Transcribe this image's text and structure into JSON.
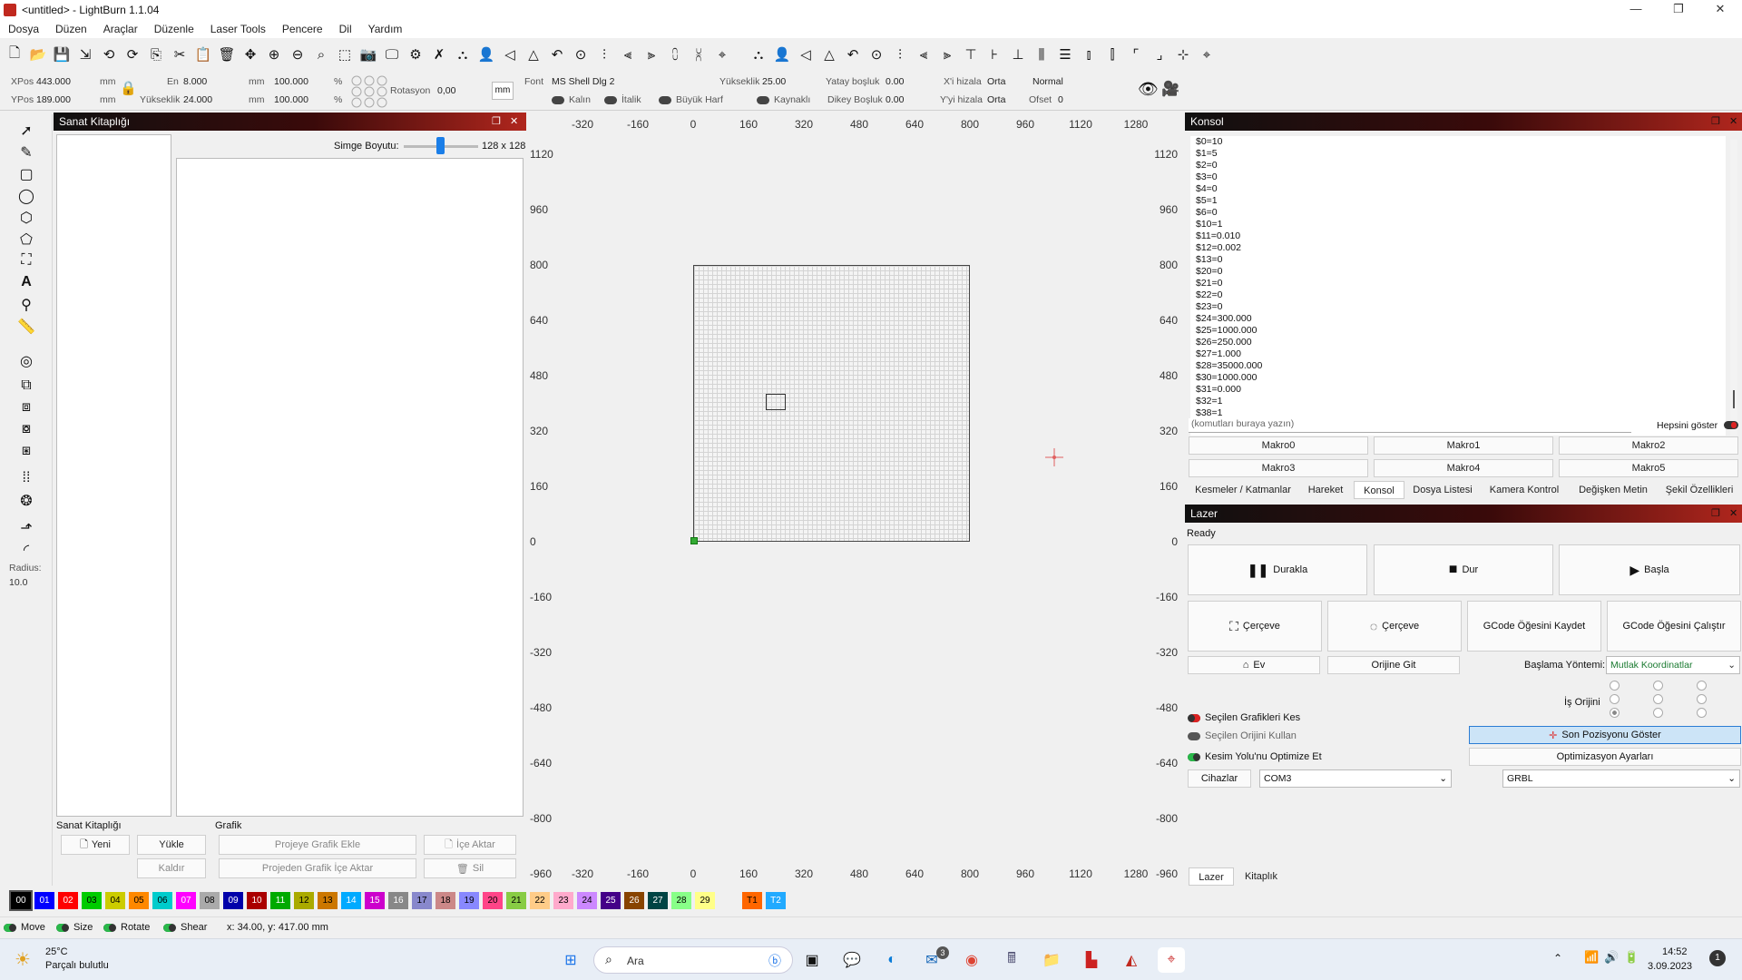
{
  "window": {
    "title": "<untitled> - LightBurn 1.1.04"
  },
  "menu": [
    "Dosya",
    "Düzen",
    "Araçlar",
    "Düzenle",
    "Laser Tools",
    "Pencere",
    "Dil",
    "Yardım"
  ],
  "props": {
    "xpos_label": "XPos",
    "xpos": "443.000",
    "ypos_label": "YPos",
    "ypos": "189.000",
    "unit": "mm",
    "en_label": "En",
    "en": "8.000",
    "yukseklik_label": "Yükseklik",
    "yukseklik": "24.000",
    "pct_w": "100.000",
    "pct_h": "100.000",
    "pct": "%",
    "rot_label": "Rotasyon",
    "rot": "0,00",
    "mm_btn": "mm",
    "font_label": "Font",
    "font_value": "MS Shell Dlg 2",
    "yuk2_label": "Yükseklik",
    "yuk2": "25.00",
    "yatay_label": "Yatay boşluk",
    "yatay": "0.00",
    "xhiza_label": "X'i hizala",
    "xhiza": "Orta",
    "normal": "Normal",
    "kalin": "Kalın",
    "italik": "İtalik",
    "buyuk": "Büyük Harf",
    "kaynakli": "Kaynaklı",
    "dikey_label": "Dikey Boşluk",
    "dikey": "0.00",
    "yhiza_label": "Y'yi hizala",
    "yhiza": "Orta",
    "ofset_label": "Ofset",
    "ofset": "0"
  },
  "left": {
    "radius_label": "Radius:",
    "radius": "10.0"
  },
  "artlib": {
    "title": "Sanat Kitaplığı",
    "icon_size_label": "Simge Boyutu:",
    "icon_size": "128 x 128",
    "section1": "Sanat Kitaplığı",
    "section2": "Grafik",
    "yeni": "Yeni",
    "yukle": "Yükle",
    "kaldir": "Kaldır",
    "proje_ekle": "Projeye Grafik Ekle",
    "ice_aktar": "İçe Aktar",
    "projeden": "Projeden Grafik İçe Aktar",
    "sil": "Sil"
  },
  "canvas": {
    "top_ticks": [
      "-320",
      "-160",
      "0",
      "160",
      "320",
      "480",
      "640",
      "800",
      "960",
      "1120",
      "1280"
    ],
    "left_ticks": [
      "1120",
      "960",
      "800",
      "640",
      "480",
      "320",
      "160",
      "0",
      "-160",
      "-320",
      "-480",
      "-640",
      "-800",
      "-960"
    ]
  },
  "console": {
    "title": "Konsol",
    "lines": [
      "$0=10",
      "$1=5",
      "$2=0",
      "$3=0",
      "$4=0",
      "$5=1",
      "$6=0",
      "$10=1",
      "$11=0.010",
      "$12=0.002",
      "$13=0",
      "$20=0",
      "$21=0",
      "$22=0",
      "$23=0",
      "$24=300.000",
      "$25=1000.000",
      "$26=250.000",
      "$27=1.000",
      "$28=35000.000",
      "$30=1000.000",
      "$31=0.000",
      "$32=1",
      "$38=1"
    ],
    "input_placeholder": "(komutları buraya yazın)",
    "hepsini": "Hepsini göster",
    "macros": [
      "Makro0",
      "Makro1",
      "Makro2",
      "Makro3",
      "Makro4",
      "Makro5"
    ],
    "tabs": [
      "Kesmeler / Katmanlar",
      "Hareket",
      "Konsol",
      "Dosya Listesi",
      "Kamera Kontrol",
      "Değişken Metin",
      "Şekil Özellikleri"
    ]
  },
  "laser": {
    "title": "Lazer",
    "status": "Ready",
    "durakla": "Durakla",
    "dur": "Dur",
    "basla": "Başla",
    "cerceve1": "Çerçeve",
    "cerceve2": "Çerçeve",
    "gcode_kaydet": "GCode Öğesini Kaydet",
    "gcode_calistir": "GCode Öğesini Çalıştır",
    "ev": "Ev",
    "orijine": "Orijine Git",
    "baslama_label": "Başlama Yöntemi:",
    "baslama": "Mutlak Koordinatlar",
    "is_orijini": "İş Orijini",
    "secilen_kes": "Seçilen Grafikleri Kes",
    "secilen_orijin": "Seçilen Orijini Kullan",
    "optimize": "Kesim Yolu'nu Optimize Et",
    "son_poz": "Son Pozisyonu Göster",
    "opt_ayar": "Optimizasyon Ayarları",
    "cihazlar": "Cihazlar",
    "port": "COM3",
    "grbl": "GRBL",
    "bottom_tabs": [
      "Lazer",
      "Kitaplık"
    ]
  },
  "palette": [
    {
      "l": "00",
      "c": "#000000",
      "t": "#ffffff"
    },
    {
      "l": "01",
      "c": "#0000ff",
      "t": "#ffffff"
    },
    {
      "l": "02",
      "c": "#ff0000",
      "t": "#ffffff"
    },
    {
      "l": "03",
      "c": "#00cc00",
      "t": "#000000"
    },
    {
      "l": "04",
      "c": "#cccc00",
      "t": "#000000"
    },
    {
      "l": "05",
      "c": "#ff8800",
      "t": "#000000"
    },
    {
      "l": "06",
      "c": "#00cccc",
      "t": "#000000"
    },
    {
      "l": "07",
      "c": "#ff00ff",
      "t": "#ffffff"
    },
    {
      "l": "08",
      "c": "#aaaaaa",
      "t": "#000000"
    },
    {
      "l": "09",
      "c": "#0000aa",
      "t": "#ffffff"
    },
    {
      "l": "10",
      "c": "#aa0000",
      "t": "#ffffff"
    },
    {
      "l": "11",
      "c": "#00aa00",
      "t": "#ffffff"
    },
    {
      "l": "12",
      "c": "#aaaa00",
      "t": "#000000"
    },
    {
      "l": "13",
      "c": "#cc7700",
      "t": "#000000"
    },
    {
      "l": "14",
      "c": "#00aaff",
      "t": "#ffffff"
    },
    {
      "l": "15",
      "c": "#cc00cc",
      "t": "#ffffff"
    },
    {
      "l": "16",
      "c": "#888888",
      "t": "#ffffff"
    },
    {
      "l": "17",
      "c": "#8888cc",
      "t": "#000000"
    },
    {
      "l": "18",
      "c": "#cc8888",
      "t": "#000000"
    },
    {
      "l": "19",
      "c": "#8888ff",
      "t": "#000000"
    },
    {
      "l": "20",
      "c": "#ff4488",
      "t": "#000000"
    },
    {
      "l": "21",
      "c": "#88cc44",
      "t": "#000000"
    },
    {
      "l": "22",
      "c": "#ffcc88",
      "t": "#000000"
    },
    {
      "l": "23",
      "c": "#ffaacc",
      "t": "#000000"
    },
    {
      "l": "24",
      "c": "#cc88ff",
      "t": "#000000"
    },
    {
      "l": "25",
      "c": "#440088",
      "t": "#ffffff"
    },
    {
      "l": "26",
      "c": "#884400",
      "t": "#ffffff"
    },
    {
      "l": "27",
      "c": "#004444",
      "t": "#ffffff"
    },
    {
      "l": "28",
      "c": "#88ff88",
      "t": "#000000"
    },
    {
      "l": "29",
      "c": "#ffff88",
      "t": "#000000"
    },
    {
      "l": "T1",
      "c": "#ff6600",
      "t": "#000000"
    },
    {
      "l": "T2",
      "c": "#22aaff",
      "t": "#ffffff"
    }
  ],
  "status": {
    "move": "Move",
    "size": "Size",
    "rotate": "Rotate",
    "shear": "Shear",
    "coords": "x: 34.00, y: 417.00 mm"
  },
  "taskbar": {
    "temp": "25°C",
    "weather": "Parçalı bulutlu",
    "search": "Ara",
    "time": "14:52",
    "date": "3.09.2023",
    "mail_badge": "3",
    "notif": "1"
  }
}
